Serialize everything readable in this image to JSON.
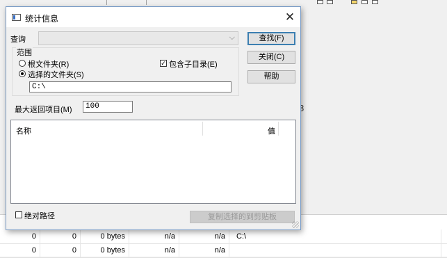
{
  "background": {
    "rows": [
      [
        "0",
        "0",
        "0 bytes",
        "n/a",
        "n/a",
        "C:\\"
      ],
      [
        "0",
        "0",
        "0 bytes",
        "n/a",
        "n/a",
        ""
      ]
    ],
    "right_glyph": "8"
  },
  "dialog": {
    "title": "统计信息",
    "close_glyph": "✕",
    "query_label": "查询",
    "query_value": "",
    "scope_label": "范围",
    "root_folder_label": "根文件夹(R)",
    "selected_folder_label": "选择的文件夹(S)",
    "include_subdirs_label": "包含子目录(E)",
    "include_subdirs_checked": true,
    "path_value": "C:\\",
    "max_results_label": "最大返回项目(M)",
    "max_results_value": "100",
    "buttons": {
      "find": "查找(F)",
      "close": "关闭(C)",
      "help": "帮助",
      "copy": "复制选择的到剪贴板"
    },
    "list": {
      "col_name": "名称",
      "col_value": "值"
    },
    "absolute_path_label": "绝对路径",
    "absolute_path_checked": false
  },
  "colors": {
    "default_button_border": "#3c7fb1",
    "dialog_border": "#7a9cc6"
  }
}
